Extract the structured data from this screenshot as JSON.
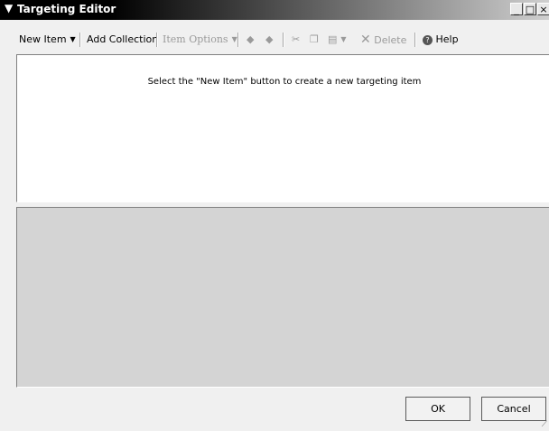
{
  "window": {
    "title": "Targeting Editor",
    "title_icon": "▼",
    "controls": {
      "minimize": "_",
      "maximize": "□",
      "close": "×"
    }
  },
  "toolbar": {
    "new_item": "New Item",
    "add_collection": "Add Collection",
    "item_options": "Item Options",
    "delete": "Delete",
    "help": "Help",
    "icons": [
      "move-up-icon",
      "move-down-icon",
      "cut-icon",
      "copy-icon",
      "paste-icon",
      "delete-x-icon",
      "help-icon"
    ]
  },
  "main": {
    "hint": "Select the \"New Item\" button to create a new targeting item"
  },
  "footer": {
    "ok": "OK",
    "cancel": "Cancel"
  }
}
